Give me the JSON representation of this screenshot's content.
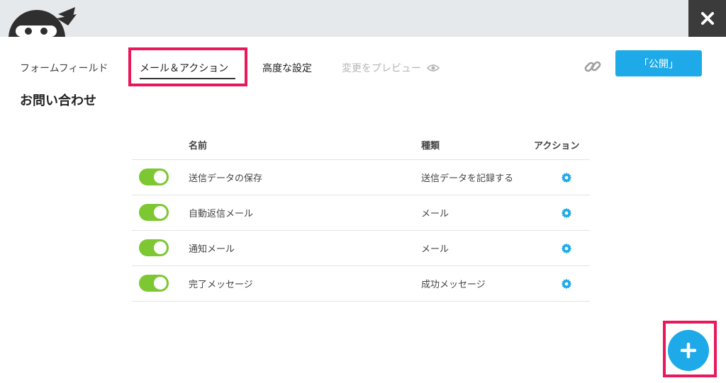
{
  "colors": {
    "accent": "#1ea9e8",
    "toggle_on": "#7dc732",
    "highlight": "#e8185a",
    "close_bg": "#3b3b3b"
  },
  "icons": {
    "logo": "ninja-logo",
    "close": "close-icon",
    "link": "link-icon",
    "preview": "eye-icon",
    "gear": "gear-icon",
    "add": "plus-icon"
  },
  "tabs": {
    "fields": "フォームフィールド",
    "email_actions": "メール＆アクション",
    "advanced": "高度な設定",
    "preview": "変更をプレビュー"
  },
  "publish_label": "「公開」",
  "form_title": "お問い合わせ",
  "table": {
    "headers": {
      "name": "名前",
      "type": "種類",
      "action": "アクション"
    },
    "rows": [
      {
        "enabled": true,
        "name": "送信データの保存",
        "type": "送信データを記録する"
      },
      {
        "enabled": true,
        "name": "自動返信メール",
        "type": "メール"
      },
      {
        "enabled": true,
        "name": "通知メール",
        "type": "メール"
      },
      {
        "enabled": true,
        "name": "完了メッセージ",
        "type": "成功メッセージ"
      }
    ]
  }
}
